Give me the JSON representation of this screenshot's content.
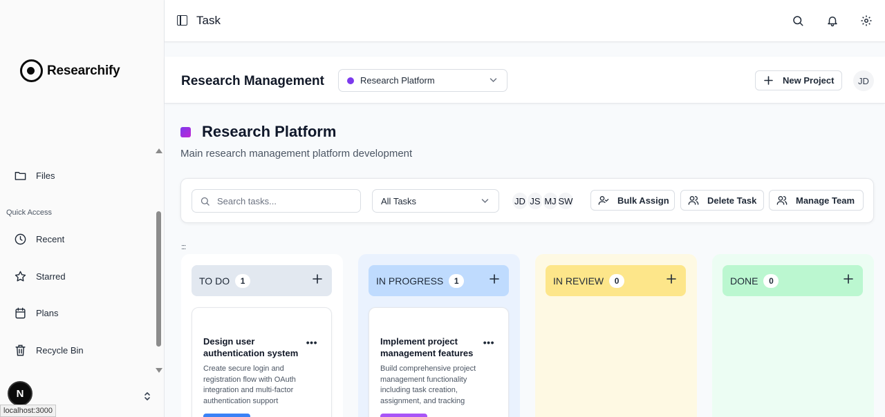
{
  "app": {
    "name": "Researchify",
    "page_title": "Task"
  },
  "sidebar": {
    "items": [
      {
        "label": "Files",
        "icon": "folder-icon"
      },
      {
        "label": "Recent",
        "icon": "clock-icon"
      },
      {
        "label": "Starred",
        "icon": "star-icon"
      },
      {
        "label": "Plans",
        "icon": "calendar-icon"
      },
      {
        "label": "Recycle Bin",
        "icon": "trash-icon"
      }
    ],
    "section_quick_access": "Quick Access",
    "badge": "N",
    "status_url": "localhost:3000"
  },
  "header": {
    "title": "Research Management",
    "project_select": {
      "value": "Research Platform",
      "dot_color": "#7c3aed"
    },
    "new_project_label": "New Project",
    "user_initials": "JD"
  },
  "project": {
    "name": "Research Platform",
    "description": "Main research management platform development"
  },
  "toolbar": {
    "search_placeholder": "Search tasks...",
    "filter_value": "All Tasks",
    "team": [
      "JD",
      "JS",
      "MJ",
      "SW"
    ],
    "bulk_assign_label": "Bulk Assign",
    "delete_task_label": "Delete Task",
    "manage_team_label": "Manage Team"
  },
  "drag_handle": ":::",
  "columns": [
    {
      "title": "TO DO",
      "count": "1",
      "bg": "#ffffff",
      "head_bg": "#e2e8f0",
      "cards": [
        {
          "title": "Design user authentication system",
          "description": "Create secure login and registration flow with OAuth integration and multi-factor authentication support",
          "tag_color": "#3b82f6"
        }
      ]
    },
    {
      "title": "IN PROGRESS",
      "count": "1",
      "bg": "#eaf2fe",
      "head_bg": "#bfdbfe",
      "cards": [
        {
          "title": "Implement project management features",
          "description": "Build comprehensive project management functionality including task creation, assignment, and tracking",
          "tag_color": "#a855f7"
        }
      ]
    },
    {
      "title": "IN REVIEW",
      "count": "0",
      "bg": "#fef9e3",
      "head_bg": "#fde68a",
      "cards": []
    },
    {
      "title": "DONE",
      "count": "0",
      "bg": "#ecfdf3",
      "head_bg": "#bbf7d0",
      "cards": []
    }
  ]
}
